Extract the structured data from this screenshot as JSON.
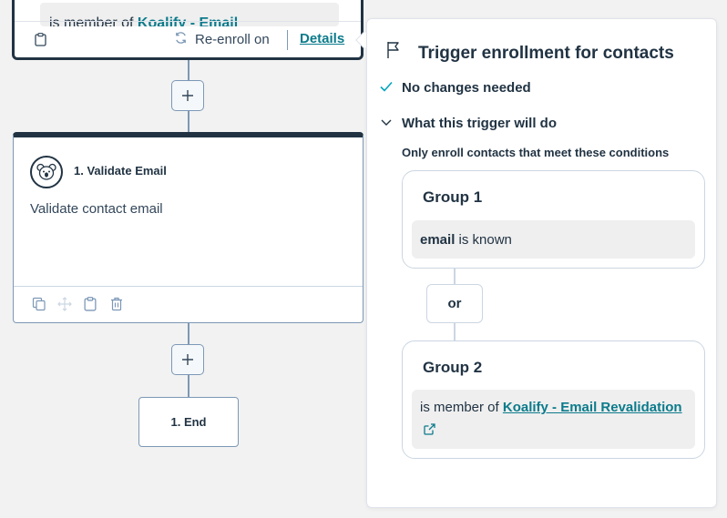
{
  "trigger_card": {
    "condition_prefix": "is member of",
    "condition_link": "Koalify - Email",
    "reenroll_label": "Re-enroll on",
    "details_label": "Details"
  },
  "action_card": {
    "title": "1. Validate Email",
    "description": "Validate contact email"
  },
  "end_card": {
    "title": "1. End"
  },
  "panel": {
    "title": "Trigger enrollment for contacts",
    "status": "No changes needed",
    "section_label": "What this trigger will do",
    "subheading": "Only enroll contacts that meet these conditions",
    "groups": [
      {
        "title": "Group 1",
        "property": "email",
        "operator": "is known"
      },
      {
        "title": "Group 2",
        "prefix": "is member of",
        "link": "Koalify - Email Revalidation"
      }
    ],
    "or_label": "or"
  },
  "colors": {
    "accent_link": "#0b7b8b",
    "dark": "#213343",
    "check": "#00a4bd"
  },
  "icons": [
    "clipboard-icon",
    "refresh-icon",
    "plus-icon",
    "koala-icon",
    "copy-icon",
    "move-icon",
    "paste-icon",
    "trash-icon",
    "flag-icon",
    "check-icon",
    "chevron-down-icon",
    "external-link-icon"
  ]
}
